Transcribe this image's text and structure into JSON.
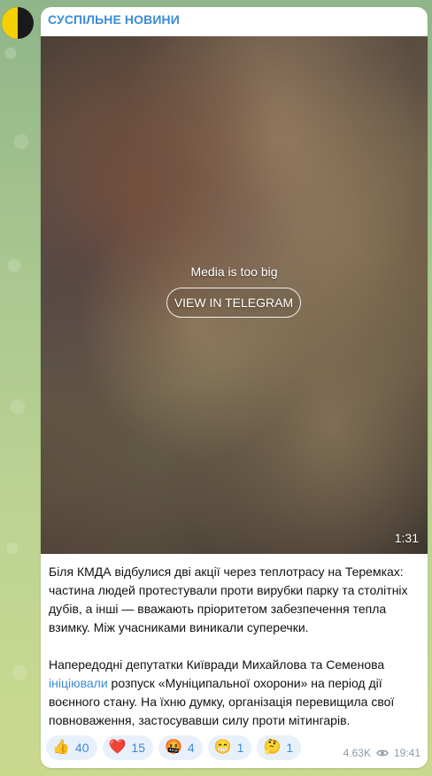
{
  "channel": {
    "name": "СУСПІЛЬНЕ НОВИНИ"
  },
  "media": {
    "note": "Media is too big",
    "button_label": "VIEW IN TELEGRAM",
    "duration": "1:31"
  },
  "post": {
    "paragraph1": "Біля КМДА відбулися дві акції через теплотрасу на Теремках: частина людей протестували проти вирубки парку та столітніх дубів, а інші — вважають пріоритетом забезпечення тепла взимку. Між учасниками виникали суперечки.",
    "paragraph2_before": "Напередодні депутатки Київради Михайлова та Семенова ",
    "paragraph2_link": "ініціювали",
    "paragraph2_after": " розпуск «Муніципальної охорони» на період дії воєнного стану. На їхню думку, організація перевищила свої повноваження, застосувавши силу проти мітингарів."
  },
  "reactions": [
    {
      "emoji": "👍",
      "count": "40"
    },
    {
      "emoji": "❤️",
      "count": "15"
    },
    {
      "emoji": "🤬",
      "count": "4"
    },
    {
      "emoji": "😁",
      "count": "1"
    },
    {
      "emoji": "🤔",
      "count": "1"
    }
  ],
  "meta": {
    "views": "4.63K",
    "time": "19:41"
  },
  "colors": {
    "accent": "#3a8bd6",
    "bubble": "#ffffff",
    "reaction_bg": "#e8f1fb"
  }
}
